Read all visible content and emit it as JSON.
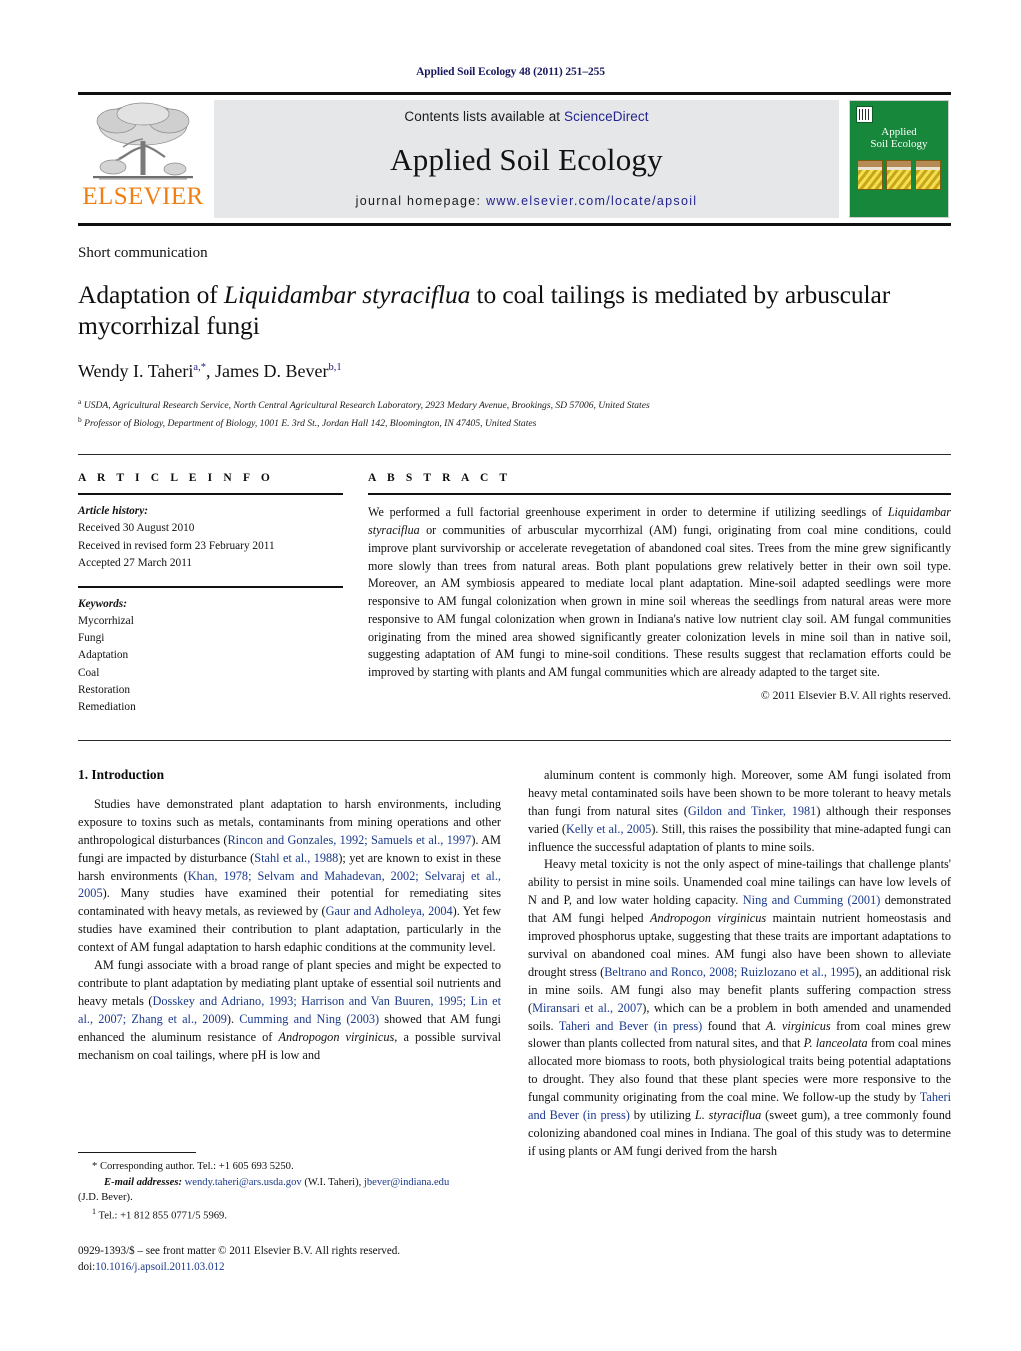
{
  "running_head": "Applied Soil Ecology 48 (2011) 251–255",
  "masthead": {
    "elsevier_wordmark": "ELSEVIER",
    "contents_prefix": "Contents lists available at ",
    "contents_link": "ScienceDirect",
    "journal_title": "Applied Soil Ecology",
    "homepage_prefix": "journal homepage: ",
    "homepage_url": "www.elsevier.com/locate/apsoil",
    "cover_title_line1": "Applied",
    "cover_title_line2": "Soil Ecology",
    "cover_color": "#17883b",
    "accent_orange": "#f07f13",
    "link_blue": "#23238e"
  },
  "article": {
    "type": "Short communication",
    "title_part1": "Adaptation of ",
    "title_italic": "Liquidambar styraciflua",
    "title_part2": " to coal tailings is mediated by arbuscular mycorrhizal fungi",
    "authors_html": "Wendy I. Taheri, James D. Bever",
    "author1": "Wendy I. Taheri",
    "author1_marks": "a,*",
    "author2": "James D. Bever",
    "author2_marks": "b,1",
    "affiliation_a_mark": "a",
    "affiliation_a": "USDA, Agricultural Research Service, North Central Agricultural Research Laboratory, 2923 Medary Avenue, Brookings, SD 57006, United States",
    "affiliation_b_mark": "b",
    "affiliation_b": "Professor of Biology, Department of Biology, 1001 E. 3rd St., Jordan Hall 142, Bloomington, IN 47405, United States"
  },
  "article_info": {
    "heading": "A R T I C L E    I N F O",
    "history_label": "Article history:",
    "history": [
      "Received 30 August 2010",
      "Received in revised form 23 February 2011",
      "Accepted 27 March 2011"
    ],
    "keywords_label": "Keywords:",
    "keywords": [
      "Mycorrhizal",
      "Fungi",
      "Adaptation",
      "Coal",
      "Restoration",
      "Remediation"
    ]
  },
  "abstract": {
    "heading": "A B S T R A C T",
    "text_1": "We performed a full factorial greenhouse experiment in order to determine if utilizing seedlings of ",
    "species_italic": "Liquidambar styraciflua",
    "text_2": " or communities of arbuscular mycorrhizal (AM) fungi, originating from coal mine conditions, could improve plant survivorship or accelerate revegetation of abandoned coal sites. Trees from the mine grew significantly more slowly than trees from natural areas. Both plant populations grew relatively better in their own soil type. Moreover, an AM symbiosis appeared to mediate local plant adaptation. Mine-soil adapted seedlings were more responsive to AM fungal colonization when grown in mine soil whereas the seedlings from natural areas were more responsive to AM fungal colonization when grown in Indiana's native low nutrient clay soil. AM fungal communities originating from the mined area showed significantly greater colonization levels in mine soil than in native soil, suggesting adaptation of AM fungi to mine-soil conditions. These results suggest that reclamation efforts could be improved by starting with plants and AM fungal communities which are already adapted to the target site.",
    "copyright": "© 2011 Elsevier B.V. All rights reserved."
  },
  "introduction": {
    "heading": "1.  Introduction",
    "left_p1_a": "Studies have demonstrated plant adaptation to harsh environments, including exposure to toxins such as metals, contaminants from mining operations and other anthropological disturbances (",
    "left_p1_ref1": "Rincon and Gonzales, 1992; Samuels et al., 1997",
    "left_p1_b": "). AM fungi are impacted by disturbance (",
    "left_p1_ref2": "Stahl et al., 1988",
    "left_p1_c": "); yet are known to exist in these harsh environments (",
    "left_p1_ref3": "Khan, 1978; Selvam and Mahadevan, 2002; Selvaraj et al., 2005",
    "left_p1_d": "). Many studies have examined their potential for remediating sites contaminated with heavy metals, as reviewed by (",
    "left_p1_ref4": "Gaur and Adholeya, 2004",
    "left_p1_e": "). Yet few studies have examined their contribution to plant adaptation, particularly in the context of AM fungal adaptation to harsh edaphic conditions at the community level.",
    "left_p2_a": "AM fungi associate with a broad range of plant species and might be expected to contribute to plant adaptation by mediating plant uptake of essential soil nutrients and heavy metals (",
    "left_p2_ref1": "Dosskey and Adriano, 1993; Harrison and Van Buuren, 1995; Lin et al., 2007; Zhang et al., 2009",
    "left_p2_b": "). ",
    "left_p2_ref2": "Cumming and Ning (2003)",
    "left_p2_c": " showed that AM fungi enhanced the aluminum resistance of ",
    "left_p2_italic": "Andropogon virginicus",
    "left_p2_d": ", a possible survival mechanism on coal tailings, where pH is low and",
    "right_p1_a": "aluminum content is commonly high. Moreover, some AM fungi isolated from heavy metal contaminated soils have been shown to be more tolerant to heavy metals than fungi from natural sites (",
    "right_p1_ref1": "Gildon and Tinker, 1981",
    "right_p1_b": ") although their responses varied (",
    "right_p1_ref2": "Kelly et al., 2005",
    "right_p1_c": "). Still, this raises the possibility that mine-adapted fungi can influence the successful adaptation of plants to mine soils.",
    "right_p2_a": "Heavy metal toxicity is not the only aspect of mine-tailings that challenge plants' ability to persist in mine soils. Unamended coal mine tailings can have low levels of N and P, and low water holding capacity. ",
    "right_p2_ref1": "Ning and Cumming (2001)",
    "right_p2_b": " demonstrated that AM fungi helped ",
    "right_p2_italic1": "Andropogon virginicus",
    "right_p2_c": " maintain nutrient homeostasis and improved phosphorus uptake, suggesting that these traits are important adaptations to survival on abandoned coal mines. AM fungi also have been shown to alleviate drought stress (",
    "right_p2_ref2": "Beltrano and Ronco, 2008; Ruizlozano et al., 1995",
    "right_p2_d": "), an additional risk in mine soils. AM fungi also may benefit plants suffering compaction stress (",
    "right_p2_ref3": "Miransari et al., 2007",
    "right_p2_e": "), which can be a problem in both amended and unamended soils. ",
    "right_p2_ref4": "Taheri and Bever (in press)",
    "right_p2_f": " found that ",
    "right_p2_italic2": "A. virginicus",
    "right_p2_g": " from coal mines grew slower than plants collected from natural sites, and that ",
    "right_p2_italic3": "P. lanceolata",
    "right_p2_h": " from coal mines allocated more biomass to roots, both physiological traits being potential adaptations to drought. They also found that these plant species were more responsive to the fungal community originating from the coal mine. We follow-up the study by ",
    "right_p2_ref5": "Taheri and Bever (in press)",
    "right_p2_i": " by utilizing ",
    "right_p2_italic4": "L. styraciflua",
    "right_p2_j": " (sweet gum), a tree commonly found colonizing abandoned coal mines in Indiana. The goal of this study was to determine if using plants or AM fungi derived from the harsh"
  },
  "footnotes": {
    "corresponding": "* Corresponding author. Tel.: +1 605 693 5250.",
    "email_label": "E-mail addresses:",
    "email1": "wendy.taheri@ars.usda.gov",
    "email1_owner": " (W.I. Taheri), ",
    "email2": "jbever@indiana.edu",
    "email2_owner": "(J.D. Bever).",
    "note1_mark": "1",
    "note1": " Tel.: +1 812 855 0771/5 5969.",
    "issn_line": "0929-1393/$ – see front matter © 2011 Elsevier B.V. All rights reserved.",
    "doi_prefix": "doi:",
    "doi": "10.1016/j.apsoil.2011.03.012"
  }
}
